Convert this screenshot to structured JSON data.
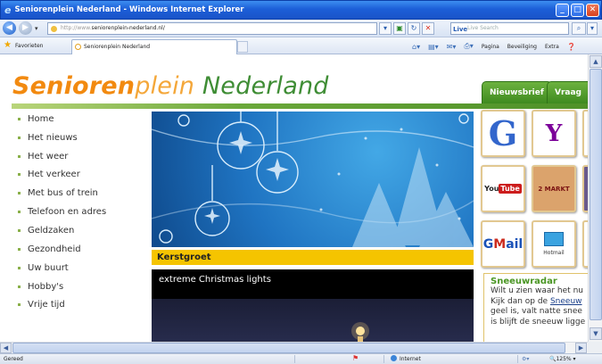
{
  "window": {
    "title": "Seniorenplein Nederland - Windows Internet Explorer",
    "minimize_glyph": "_",
    "maximize_glyph": "□",
    "close_glyph": "✕"
  },
  "address_bar": {
    "prefix": "http://www.",
    "url": "seniorenplein-nederland.nl/",
    "search_brand": "Live",
    "search_placeholder": "Live Search"
  },
  "favorites_bar": {
    "favorites_label": "Favorieten",
    "tab_title": "Seniorenplein Nederland"
  },
  "command_bar": {
    "page_label": "Pagina",
    "safety_label": "Beveiliging",
    "extra_label": "Extra"
  },
  "site": {
    "logo": {
      "part1": "Senioren",
      "part2": "plein",
      "part3": " Nederland"
    },
    "tabs": [
      {
        "label": "Nieuwsbrief"
      },
      {
        "label": "Vraag"
      }
    ],
    "menu": [
      {
        "label": "Home"
      },
      {
        "label": "Het nieuws"
      },
      {
        "label": "Het weer"
      },
      {
        "label": "Het verkeer"
      },
      {
        "label": "Met bus of trein"
      },
      {
        "label": "Telefoon en adres"
      },
      {
        "label": "Geldzaken"
      },
      {
        "label": "Gezondheid"
      },
      {
        "label": "Uw buurt"
      },
      {
        "label": "Hobby's"
      },
      {
        "label": "Vrije tijd"
      }
    ],
    "banner_caption": "Kerstgroet",
    "video_title": "extreme Christmas lights",
    "tiles": {
      "google": "G",
      "yahoo": "Y",
      "youtube_you": "You",
      "youtube_tube": "Tube",
      "marktplaats": "2 MARKT",
      "gmail_g": "G",
      "gmail_m": "M",
      "gmail_ail": "ail",
      "hotmail": "Hotmail"
    },
    "sneeuwradar": {
      "title": "Sneeuwradar",
      "line1": "Wilt u zien waar het nu",
      "line2_prefix": "Kijk dan op de ",
      "line2_link": "Sneeuw",
      "line3": "geel is, valt natte snee",
      "line4": "is blijft de sneeuw ligge"
    }
  },
  "status_bar": {
    "ready": "Gereed",
    "zone": "Internet",
    "zoom": "125%"
  },
  "colors": {
    "titlebar": "#1c5fd8",
    "logo_orange": "#f28a10",
    "logo_green": "#3f8d35",
    "menu_bullet": "#8ab04a",
    "caption_yellow": "#f5c400",
    "tab_green": "#3e8a1f"
  }
}
